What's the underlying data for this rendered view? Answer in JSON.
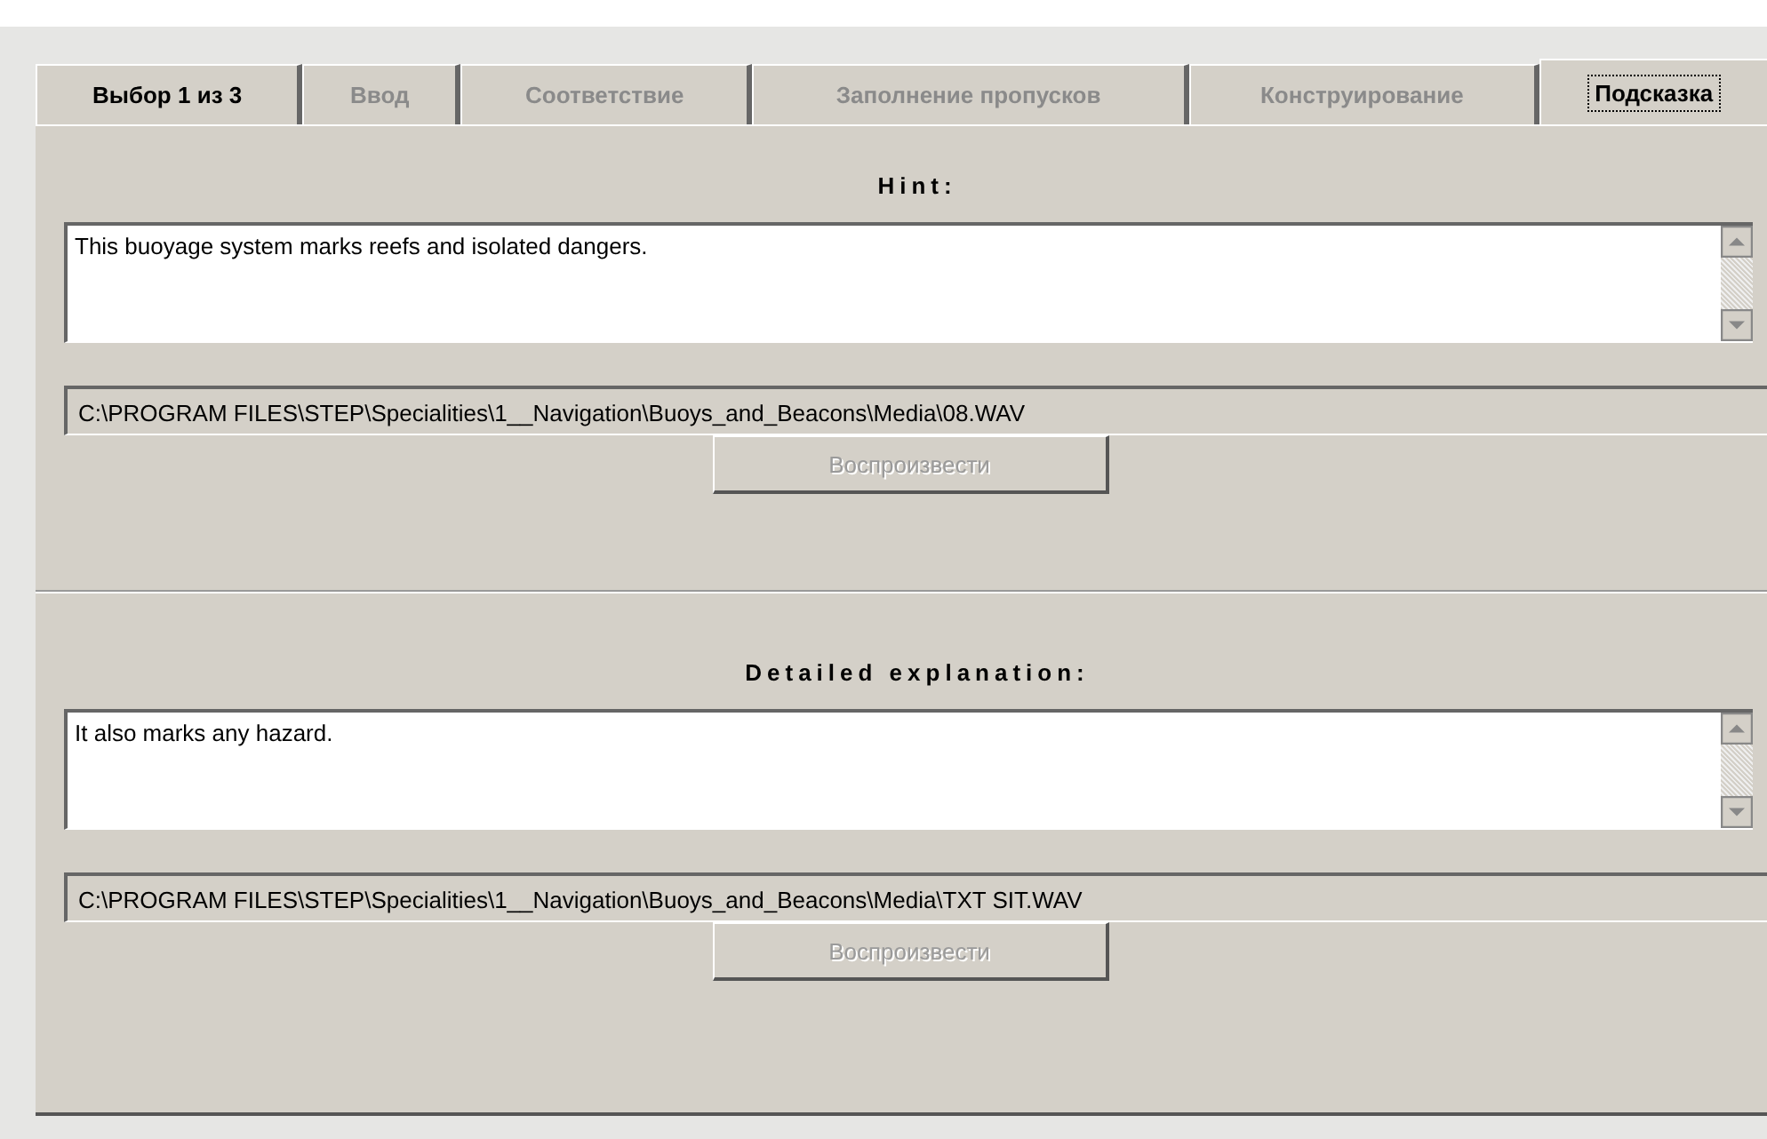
{
  "tabs": [
    {
      "label": "Выбор 1 из 3",
      "selected": false,
      "disabled": false
    },
    {
      "label": "Ввод",
      "selected": false,
      "disabled": true
    },
    {
      "label": "Соответствие",
      "selected": false,
      "disabled": true
    },
    {
      "label": "Заполнение пропусков",
      "selected": false,
      "disabled": true
    },
    {
      "label": "Конструирование",
      "selected": false,
      "disabled": true
    },
    {
      "label": "Подсказка",
      "selected": true,
      "disabled": false
    }
  ],
  "sections": [
    {
      "heading": "Hint:",
      "text": "This buoyage system marks reefs and isolated dangers.",
      "path": "C:\\PROGRAM FILES\\STEP\\Specialities\\1__Navigation\\Buoys_and_Beacons\\Media\\08.WAV",
      "button": {
        "label": "Воспроизвести",
        "disabled": true
      }
    },
    {
      "heading": "Detailed explanation:",
      "text": "It also marks any hazard.",
      "path": "C:\\PROGRAM FILES\\STEP\\Specialities\\1__Navigation\\Buoys_and_Beacons\\Media\\TXT SIT.WAV",
      "button": {
        "label": "Воспроизвести",
        "disabled": true
      }
    }
  ]
}
